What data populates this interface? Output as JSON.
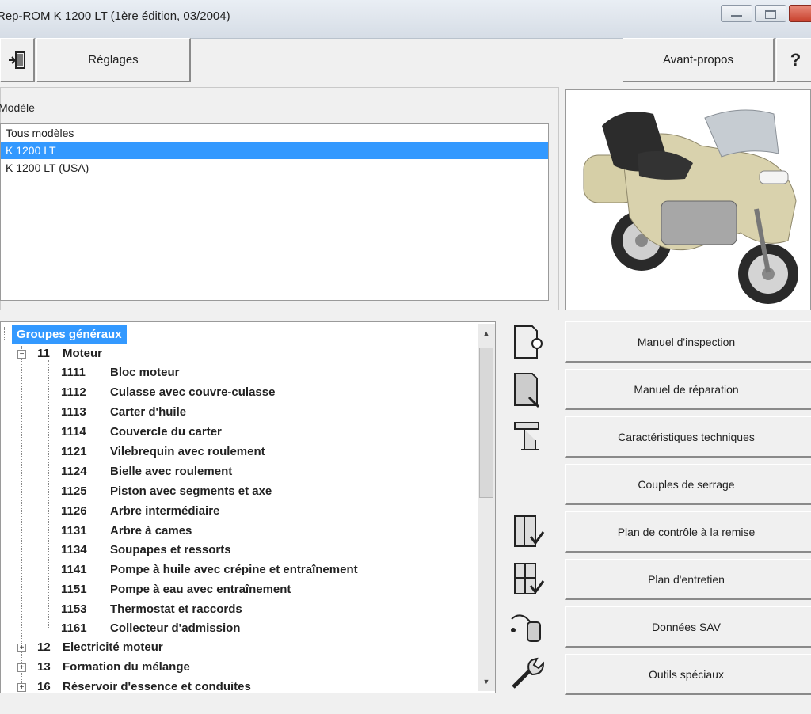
{
  "window": {
    "title": "Rep-ROM K 1200 LT (1ère édition, 03/2004)"
  },
  "toolbar": {
    "reglages": "Réglages",
    "avant_propos": "Avant-propos",
    "help": "?"
  },
  "model": {
    "label": "Modèle",
    "items": [
      "Tous modèles",
      "K 1200 LT",
      "K 1200 LT (USA)"
    ],
    "selected": "K 1200 LT"
  },
  "tree": {
    "root": "Groupes généraux",
    "group": {
      "code": "11",
      "name": "Moteur"
    },
    "children": [
      {
        "code": "1111",
        "name": "Bloc moteur"
      },
      {
        "code": "1112",
        "name": "Culasse avec couvre-culasse"
      },
      {
        "code": "1113",
        "name": "Carter d'huile"
      },
      {
        "code": "1114",
        "name": "Couvercle du carter"
      },
      {
        "code": "1121",
        "name": "Vilebrequin avec roulement"
      },
      {
        "code": "1124",
        "name": "Bielle avec roulement"
      },
      {
        "code": "1125",
        "name": "Piston avec segments et axe"
      },
      {
        "code": "1126",
        "name": "Arbre intermédiaire"
      },
      {
        "code": "1131",
        "name": "Arbre à cames"
      },
      {
        "code": "1134",
        "name": "Soupapes et ressorts"
      },
      {
        "code": "1141",
        "name": "Pompe à huile avec crépine et entraînement"
      },
      {
        "code": "1151",
        "name": "Pompe à eau avec entraînement"
      },
      {
        "code": "1153",
        "name": "Thermostat et raccords"
      },
      {
        "code": "1161",
        "name": "Collecteur d'admission"
      }
    ],
    "collapsed_groups": [
      {
        "code": "12",
        "name": "Electricité moteur"
      },
      {
        "code": "13",
        "name": "Formation du mélange"
      },
      {
        "code": "16",
        "name": "Réservoir d'essence et conduites"
      }
    ]
  },
  "actions": [
    "Manuel d'inspection",
    "Manuel de réparation",
    "Caractéristiques techniques",
    "Couples de serrage",
    "Plan de contrôle à la remise",
    "Plan d'entretien",
    "Données SAV",
    "Outils spéciaux"
  ],
  "colors": {
    "selection": "#3399ff",
    "window_bg": "#f0f0f0"
  }
}
